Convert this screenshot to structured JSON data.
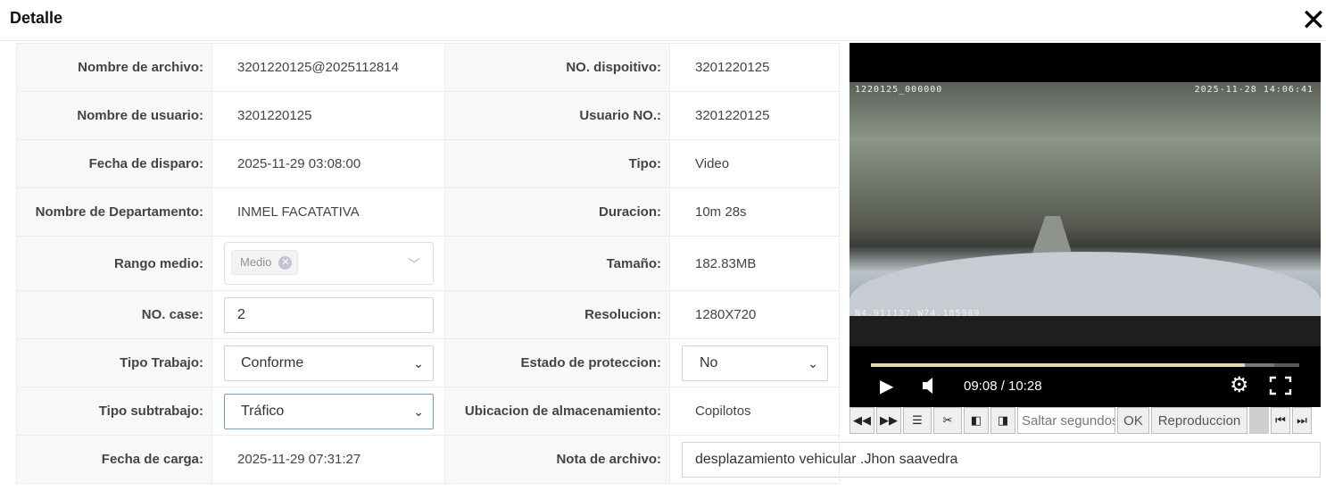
{
  "dialog": {
    "title": "Detalle"
  },
  "rows": [
    {
      "label_left": "Nombre de archivo:",
      "value_left": "3201220125@2025112814",
      "label_right": "NO. dispoitivo:",
      "value_right": "3201220125"
    },
    {
      "label_left": "Nombre de usuario:",
      "value_left": "3201220125",
      "label_right": "Usuario NO.:",
      "value_right": "3201220125"
    },
    {
      "label_left": "Fecha de disparo:",
      "value_left": "2025-11-29 03:08:00",
      "label_right": "Tipo:",
      "value_right": "Video"
    },
    {
      "label_left": "Nombre de Departamento:",
      "value_left": "INMEL FACATATIVA",
      "label_right": "Duracion:",
      "value_right": "10m 28s"
    },
    {
      "label_left": "Rango medio:",
      "tag": "Medio",
      "label_right": "Tamaño:",
      "value_right": "182.83MB"
    },
    {
      "label_left": "NO. case:",
      "input_value": "2",
      "label_right": "Resolucion:",
      "value_right": "1280X720"
    },
    {
      "label_left": "Tipo Trabajo:",
      "select_value": "Conforme",
      "label_right": "Estado de proteccion:",
      "select_right": "No"
    },
    {
      "label_left": "Tipo subtrabajo:",
      "select_value": "Tráfico",
      "label_right": "Ubicacion de almacenamiento:",
      "value_right": "Copilotos"
    },
    {
      "label_left": "Fecha de carga:",
      "value_left": "2025-11-29 07:31:27",
      "label_right": "Nota de archivo:",
      "note_value": "desplazamiento vehicular .Jhon saavedra"
    }
  ],
  "video": {
    "osd_top_left": "1220125_000000",
    "osd_top_right": "2025-11-28 14:06:41",
    "osd_bottom_left": "N4.911137 W74.185989",
    "time_display": "09:08 / 10:28",
    "progress_fraction": 0.873,
    "buffer_fraction": 0.942
  },
  "toolbar": {
    "skip_placeholder": "Saltar segundos",
    "ok_label": "OK",
    "playback_label": "Reproduccion"
  },
  "icons": {
    "close": "close-icon",
    "play": "play-icon",
    "volume": "volume-icon",
    "settings": "gear-icon",
    "fullscreen": "fullscreen-icon"
  }
}
